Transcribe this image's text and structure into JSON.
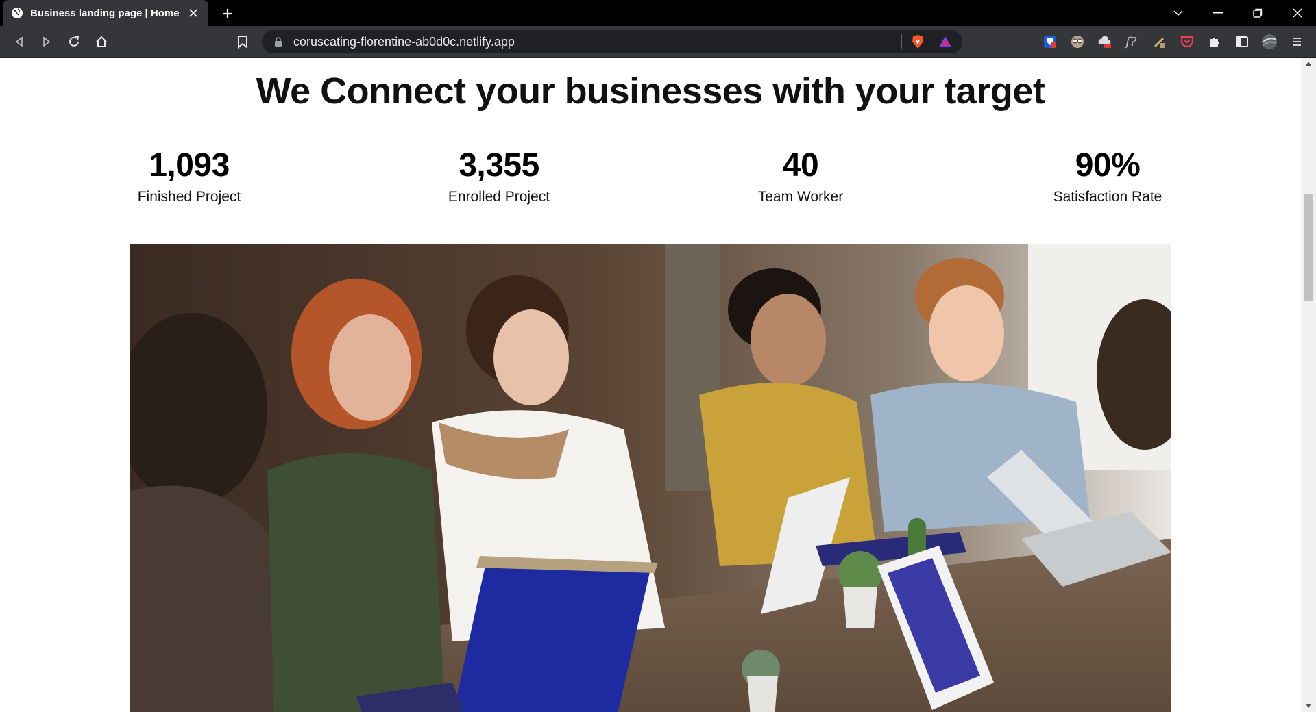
{
  "browser": {
    "tab_title": "Business landing page | Home",
    "url": "coruscating-florentine-ab0d0c.netlify.app"
  },
  "page": {
    "headline": "We Connect your businesses with your target",
    "stats": [
      {
        "value": "1,093",
        "label": "Finished Project"
      },
      {
        "value": "3,355",
        "label": "Enrolled Project"
      },
      {
        "value": "40",
        "label": "Team Worker"
      },
      {
        "value": "90%",
        "label": "Satisfaction Rate"
      }
    ],
    "hero_image": {
      "description_icon": "team-meeting-photo"
    }
  },
  "colors": {
    "chrome_dark": "#35363a",
    "titlebar": "#000000",
    "brave_orange": "#fb542b",
    "page_bg": "#ffffff",
    "text": "#111111"
  }
}
